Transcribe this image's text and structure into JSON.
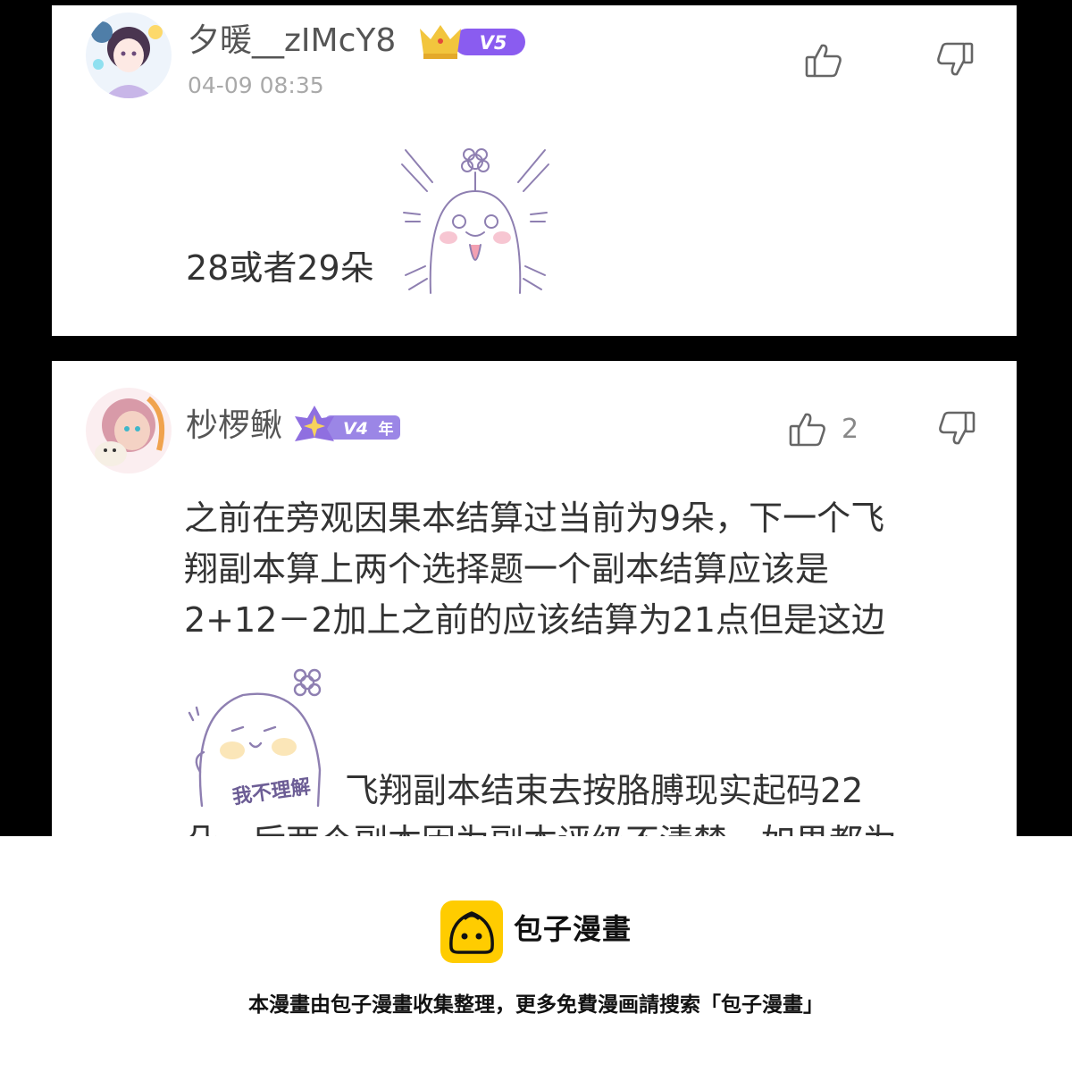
{
  "comments": [
    {
      "username": "夕暖__zIMcY8",
      "level_badge": "V5",
      "timestamp": "04-09 08:35",
      "text": "28或者29朵",
      "sticker": "crying-bean-sticker",
      "like_count": ""
    },
    {
      "username": "杪椤鳅",
      "level_badge": "V4",
      "badge_suffix": "年",
      "like_count": "2",
      "text_lines": [
        "之前在旁观因果本结算过当前为9朵，下一个飞",
        "翔副本算上两个选择题一个副本结算应该是",
        "2+12－2加上之前的应该结算为21点但是这边"
      ],
      "sticker_caption": "我不理解",
      "text_after_sticker": "飞翔副本结束去按胳膊现实起码22",
      "text_cutoff": "朵，后两个副本因为副本评级不清楚，如果都为"
    }
  ],
  "footer": {
    "brand": "包子漫畫",
    "note": "本漫畫由包子漫畫收集整理，更多免費漫画請搜索「包子漫畫」"
  },
  "colors": {
    "badge_purple": "#8a5cf0",
    "crown_gold": "#f2c53d",
    "logo_yellow": "#ffcc00"
  },
  "icons": [
    "thumbs-up-icon",
    "thumbs-down-icon"
  ]
}
